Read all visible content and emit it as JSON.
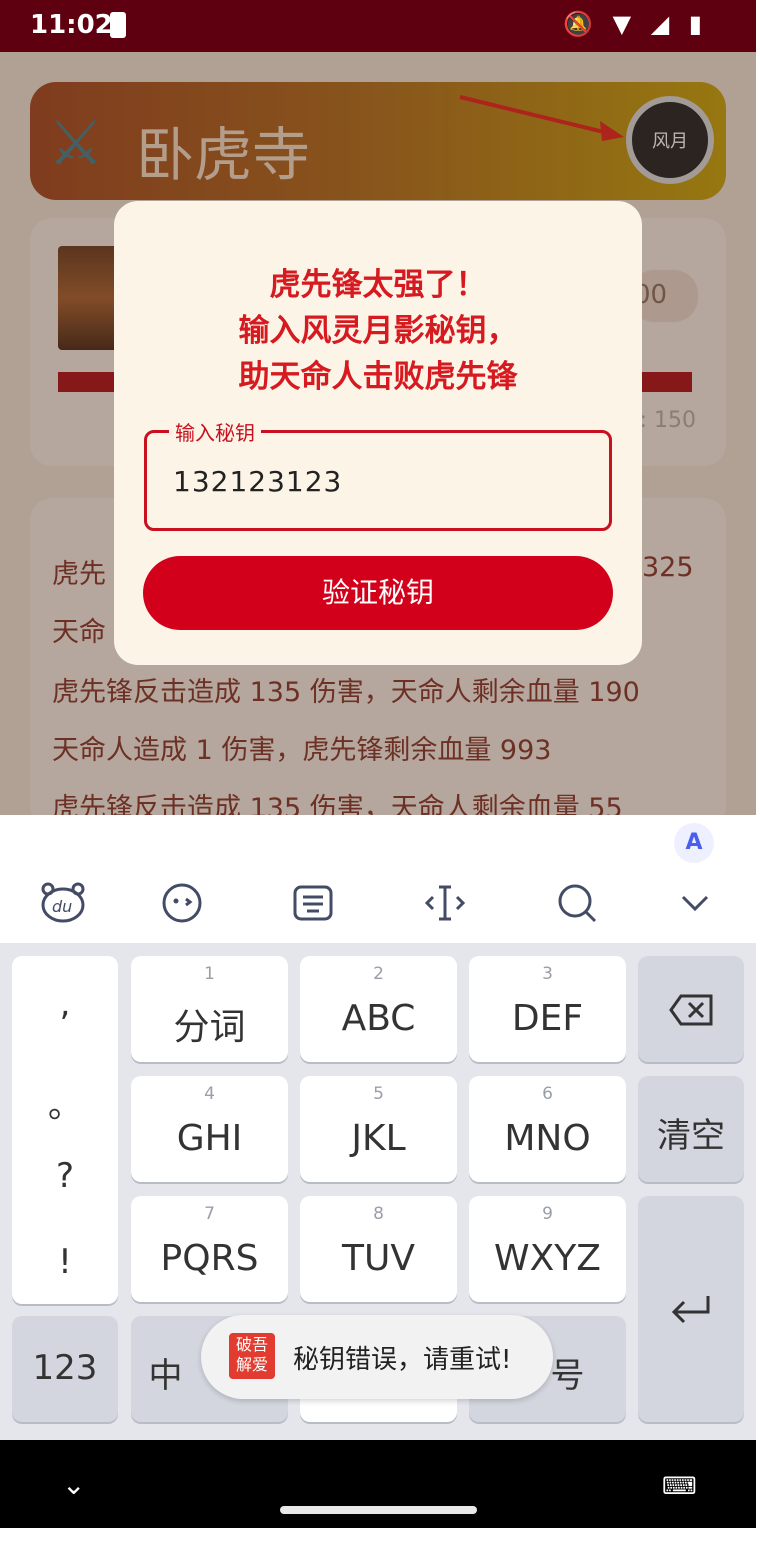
{
  "status_bar": {
    "time": "11:02",
    "icons": "🔕 ▼ ◢ ▮"
  },
  "banner": {
    "title": "卧虎寺",
    "logo_text": "风月"
  },
  "card1": {
    "value_partial": "00",
    "hp_label_partial": ": 150"
  },
  "battle_log": [
    "虎先锋造成 ... 伤害，天命人剩余血量 325",
    "天命人造成 ...",
    "虎先锋反击造成 135 伤害，天命人剩余血量 190",
    "天命人造成 1 伤害，虎先锋剩余血量 993",
    "虎先锋反击造成 135 伤害，天命人剩余血量 55"
  ],
  "battle_log_visible": {
    "line1_left": "虎先",
    "line1_right": "325",
    "line2_left": "天命",
    "line3": "虎先锋反击造成 135 伤害，天命人剩余血量 190",
    "line4": "天命人造成 1 伤害，虎先锋剩余血量 993",
    "line5": "虎先锋反击造成 135 伤害，天命人剩余血量 55"
  },
  "dialog": {
    "line1": "虎先锋太强了！",
    "line2": "输入风灵月影秘钥，",
    "line3": "助天命人击败虎先锋",
    "field_label": "输入秘钥",
    "field_value": "132123123",
    "verify_button": "验证秘钥"
  },
  "keyboard": {
    "punct": [
      ",",
      "。",
      "?",
      "!"
    ],
    "keys": [
      {
        "num": "1",
        "label": "分词"
      },
      {
        "num": "2",
        "label": "ABC"
      },
      {
        "num": "3",
        "label": "DEF"
      },
      {
        "num": "4",
        "label": "GHI"
      },
      {
        "num": "5",
        "label": "JKL"
      },
      {
        "num": "6",
        "label": "MNO"
      },
      {
        "num": "7",
        "label": "PQRS"
      },
      {
        "num": "8",
        "label": "TUV"
      },
      {
        "num": "9",
        "label": "WXYZ"
      }
    ],
    "clear": "清空",
    "mode_123": "123",
    "mode_zh": "中",
    "symbol_partial": "号"
  },
  "toast": {
    "badge": "破吾解爱",
    "text": "秘钥错误，请重试!"
  },
  "colors": {
    "primary": "#d2001a",
    "status_bar": "#5e0010",
    "dialog_bg": "#fbf4e7"
  }
}
